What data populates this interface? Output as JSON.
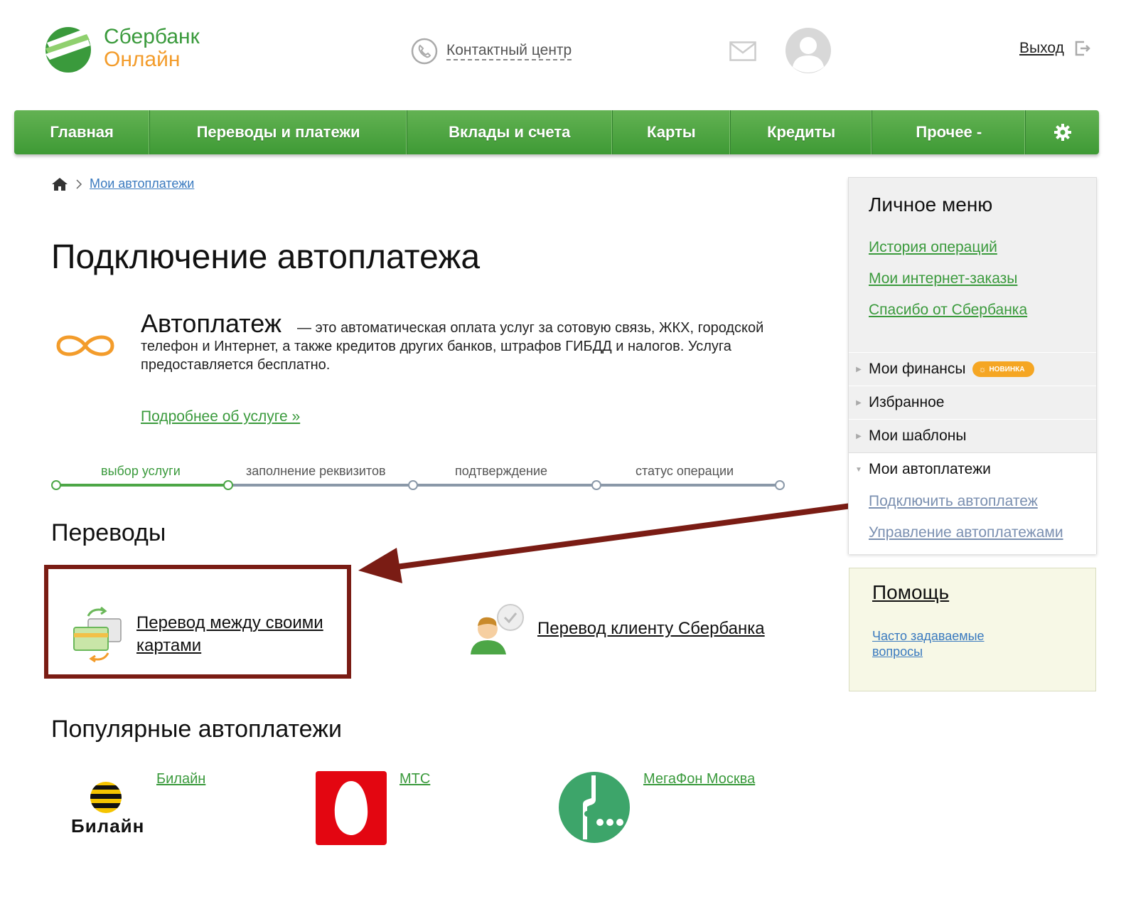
{
  "header": {
    "logo_line1": "Сбербанк",
    "logo_line2": "Онлайн",
    "contact_label": "Контактный центр",
    "exit_label": "Выход"
  },
  "nav": {
    "items": [
      "Главная",
      "Переводы и платежи",
      "Вклады и счета",
      "Карты",
      "Кредиты",
      "Прочее -"
    ]
  },
  "breadcrumb": {
    "current": "Мои автоплатежи"
  },
  "page": {
    "title": "Подключение автоплатежа",
    "intro_title": "Автоплатеж",
    "intro_text": "— это автоматическая оплата услуг за сотовую связь, ЖКХ, городской телефон и Интернет, а также кредитов других банков, штрафов ГИБДД и налогов. Услуга предоставляется бесплатно.",
    "more_link": "Подробнее об услуге »"
  },
  "steps": {
    "items": [
      "выбор услуги",
      "заполнение реквизитов",
      "подтверждение",
      "статус операции"
    ],
    "current": 1
  },
  "transfers": {
    "heading": "Переводы",
    "own_cards_line1": "Перевод между своими",
    "own_cards_line2": "картами",
    "to_client": "Перевод клиенту Сбербанка"
  },
  "popular": {
    "heading": "Популярные автоплатежи",
    "beeline_logo_text": "Билайн",
    "operators": [
      "Билайн",
      "МТС",
      "МегаФон Москва"
    ]
  },
  "side_menu": {
    "title": "Личное меню",
    "links": [
      "История операций",
      "Мои интернет-заказы",
      "Спасибо от Сбербанка"
    ],
    "sections": [
      "Мои финансы",
      "Избранное",
      "Мои шаблоны"
    ],
    "badge": "НОВИНКА",
    "open_section": "Мои автоплатежи",
    "sub_links": [
      "Подключить автоплатеж",
      "Управление автоплатежами"
    ]
  },
  "help": {
    "title": "Помощь",
    "link": "Часто задаваемые вопросы"
  },
  "colors": {
    "brand_green": "#3a9a3c",
    "brand_orange": "#f39c2b",
    "annotation_red": "#7a1c14"
  }
}
